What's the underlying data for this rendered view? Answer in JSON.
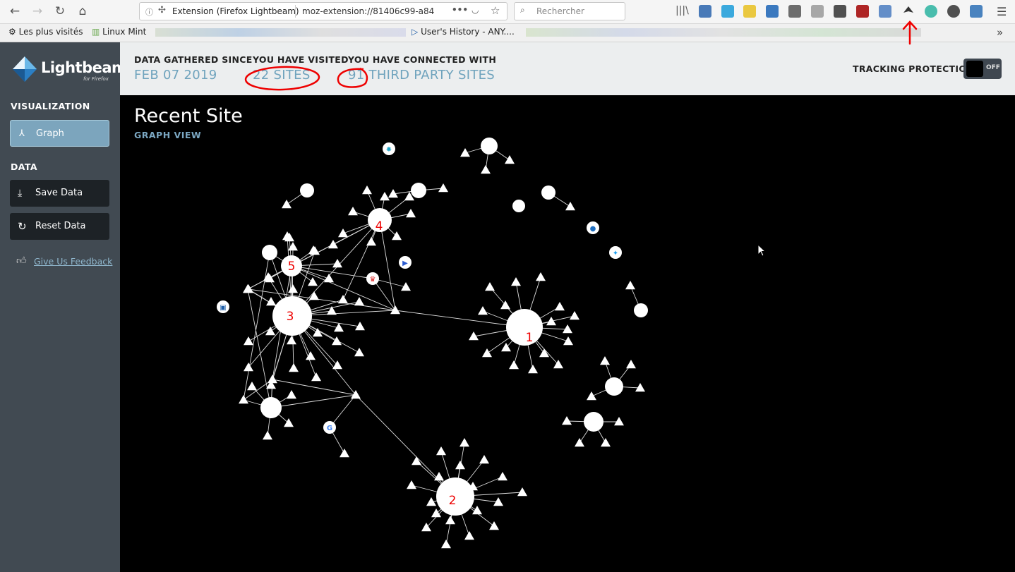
{
  "browser": {
    "url_title": "Extension (Firefox Lightbeam)",
    "url": "moz-extension://81406c99-a84",
    "search_placeholder": "Rechercher",
    "bookmarks": [
      {
        "label": "Les plus visités"
      },
      {
        "label": "Linux Mint"
      },
      {
        "label": "User's History - ANY...."
      }
    ],
    "extension_colors": [
      "#2a64ad",
      "#1a9bd8",
      "#e8c020",
      "#1a63b5",
      "#555",
      "#999",
      "#333",
      "#a10000",
      "#4a7bc0",
      "#2ab3a0",
      "#333",
      "#2c6fb5",
      "#777",
      "#222"
    ]
  },
  "app": {
    "logo_name": "Lightbeam",
    "logo_sub": "for Firefox",
    "section_visualization": "VISUALIZATION",
    "graph_button": "Graph",
    "section_data": "DATA",
    "save_button": "Save Data",
    "reset_button": "Reset Data",
    "feedback_link": "Give Us Feedback",
    "header": {
      "since_label": "DATA GATHERED SINCE",
      "since_value": "FEB 07 2019",
      "visited_label": "YOU HAVE VISITED",
      "visited_value": "22 SITES",
      "connected_label": "YOU HAVE CONNECTED WITH",
      "connected_value": "91 THIRD PARTY SITES",
      "tracking_label": "TRACKING PROTECTION",
      "tracking_toggle": "OFF"
    },
    "main_title": "Recent Site",
    "view_name": "GRAPH VIEW"
  },
  "graph": {
    "hub_labels": [
      "1",
      "2",
      "3",
      "4",
      "5"
    ],
    "favicon_names": [
      "firefox-icon",
      "google-icon",
      "twitter-icon",
      "crown-icon",
      "sparkle-icon",
      "monitor-icon",
      "vidyard-icon"
    ]
  }
}
